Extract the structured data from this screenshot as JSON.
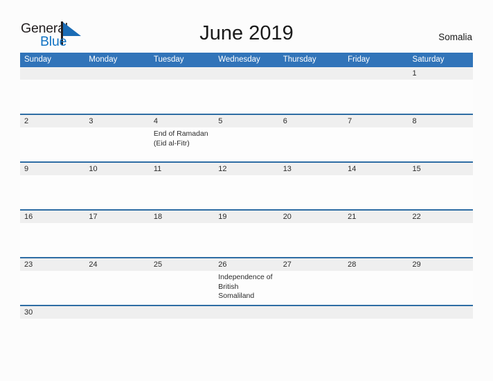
{
  "brand": {
    "name_part1": "General",
    "name_part2": "Blue",
    "flag_icon": "blue-triangle-flag-icon"
  },
  "header": {
    "title": "June 2019",
    "country": "Somalia"
  },
  "calendar": {
    "month": "June",
    "year": "2019",
    "weekday_headers": [
      "Sunday",
      "Monday",
      "Tuesday",
      "Wednesday",
      "Thursday",
      "Friday",
      "Saturday"
    ],
    "weeks": [
      {
        "days": [
          {
            "num": "",
            "events": []
          },
          {
            "num": "",
            "events": []
          },
          {
            "num": "",
            "events": []
          },
          {
            "num": "",
            "events": []
          },
          {
            "num": "",
            "events": []
          },
          {
            "num": "",
            "events": []
          },
          {
            "num": "1",
            "events": []
          }
        ]
      },
      {
        "days": [
          {
            "num": "2",
            "events": []
          },
          {
            "num": "3",
            "events": []
          },
          {
            "num": "4",
            "events": [
              "End of Ramadan",
              "(Eid al-Fitr)"
            ]
          },
          {
            "num": "5",
            "events": []
          },
          {
            "num": "6",
            "events": []
          },
          {
            "num": "7",
            "events": []
          },
          {
            "num": "8",
            "events": []
          }
        ]
      },
      {
        "days": [
          {
            "num": "9",
            "events": []
          },
          {
            "num": "10",
            "events": []
          },
          {
            "num": "11",
            "events": []
          },
          {
            "num": "12",
            "events": []
          },
          {
            "num": "13",
            "events": []
          },
          {
            "num": "14",
            "events": []
          },
          {
            "num": "15",
            "events": []
          }
        ]
      },
      {
        "days": [
          {
            "num": "16",
            "events": []
          },
          {
            "num": "17",
            "events": []
          },
          {
            "num": "18",
            "events": []
          },
          {
            "num": "19",
            "events": []
          },
          {
            "num": "20",
            "events": []
          },
          {
            "num": "21",
            "events": []
          },
          {
            "num": "22",
            "events": []
          }
        ]
      },
      {
        "days": [
          {
            "num": "23",
            "events": []
          },
          {
            "num": "24",
            "events": []
          },
          {
            "num": "25",
            "events": []
          },
          {
            "num": "26",
            "events": [
              "Independence of",
              "British Somaliland"
            ]
          },
          {
            "num": "27",
            "events": []
          },
          {
            "num": "28",
            "events": []
          },
          {
            "num": "29",
            "events": []
          }
        ]
      },
      {
        "last": true,
        "days": [
          {
            "num": "30",
            "events": []
          },
          {
            "num": "",
            "events": []
          },
          {
            "num": "",
            "events": []
          },
          {
            "num": "",
            "events": []
          },
          {
            "num": "",
            "events": []
          },
          {
            "num": "",
            "events": []
          },
          {
            "num": "",
            "events": []
          }
        ]
      }
    ]
  },
  "colors": {
    "header_blue": "#3174b9",
    "rule_blue": "#2e6da4",
    "date_band_gray": "#efefef",
    "brand_blue": "#1274c4",
    "page_background": "#fcfcfc"
  }
}
